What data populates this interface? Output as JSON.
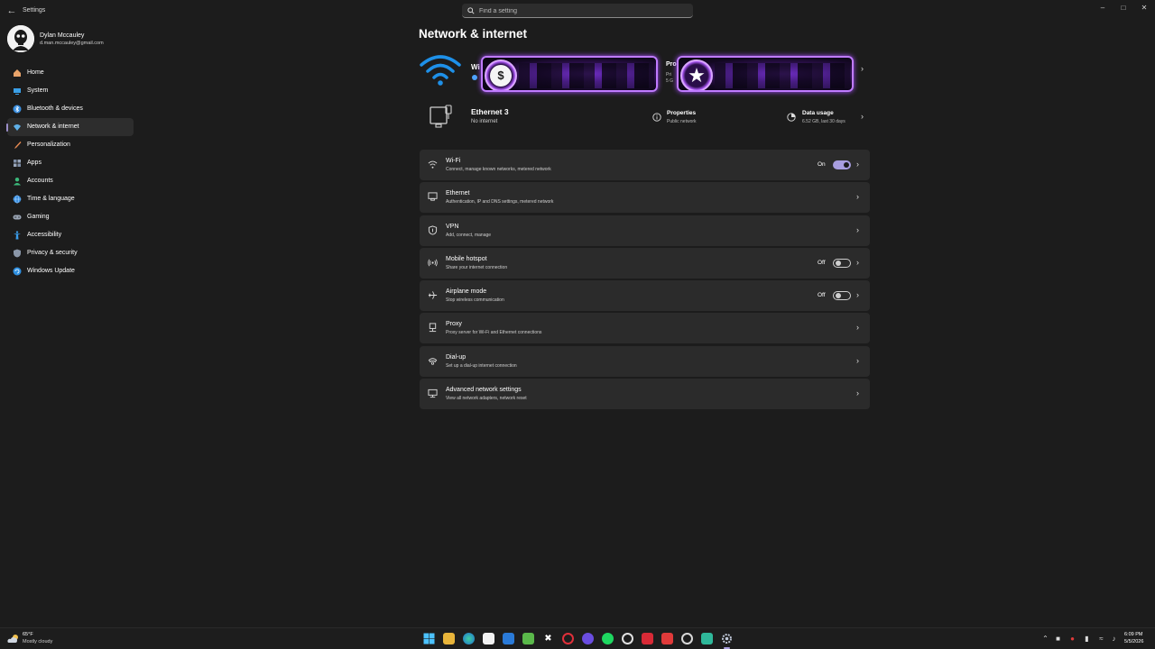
{
  "window": {
    "title": "Settings",
    "search_placeholder": "Find a setting"
  },
  "user": {
    "name": "Dylan Mccauley",
    "email": "d.man.mccauley@gmail.com"
  },
  "sidebar": {
    "items": [
      {
        "label": "Home",
        "icon": "home-icon",
        "color": "#e8a36a"
      },
      {
        "label": "System",
        "icon": "system-icon",
        "color": "#3aa0e8"
      },
      {
        "label": "Bluetooth & devices",
        "icon": "bluetooth-icon",
        "color": "#3a8fe0"
      },
      {
        "label": "Network & internet",
        "icon": "network-icon",
        "color": "#5fb0e8",
        "active": true
      },
      {
        "label": "Personalization",
        "icon": "brush-icon",
        "color": "#e88a52"
      },
      {
        "label": "Apps",
        "icon": "apps-icon",
        "color": "#7f8fa8"
      },
      {
        "label": "Accounts",
        "icon": "accounts-icon",
        "color": "#3bb87a"
      },
      {
        "label": "Time & language",
        "icon": "globe-icon",
        "color": "#3a8fe0"
      },
      {
        "label": "Gaming",
        "icon": "gamepad-icon",
        "color": "#9aa5b5"
      },
      {
        "label": "Accessibility",
        "icon": "accessibility-icon",
        "color": "#3a9be8"
      },
      {
        "label": "Privacy & security",
        "icon": "shield-icon",
        "color": "#8a96a8"
      },
      {
        "label": "Windows Update",
        "icon": "update-icon",
        "color": "#2e8fe0"
      }
    ]
  },
  "main": {
    "title": "Network & internet",
    "hero": {
      "wifi_label": "Wi",
      "props_label": "Pro",
      "props_sub1": "Pri",
      "props_sub2": "5 G"
    },
    "ethernet": {
      "name": "Ethernet 3",
      "status": "No internet",
      "properties_label": "Properties",
      "properties_sub": "Public network",
      "usage_label": "Data usage",
      "usage_sub": "6.52 GB, last 30 days"
    },
    "rows": [
      {
        "title": "Wi-Fi",
        "sub": "Connect, manage known networks, metered network",
        "toggle": "On"
      },
      {
        "title": "Ethernet",
        "sub": "Authentication, IP and DNS settings, metered network"
      },
      {
        "title": "VPN",
        "sub": "Add, connect, manage"
      },
      {
        "title": "Mobile hotspot",
        "sub": "Share your internet connection",
        "toggle": "Off"
      },
      {
        "title": "Airplane mode",
        "sub": "Stop wireless communication",
        "toggle": "Off"
      },
      {
        "title": "Proxy",
        "sub": "Proxy server for Wi-Fi and Ethernet connections"
      },
      {
        "title": "Dial-up",
        "sub": "Set up a dial-up internet connection"
      },
      {
        "title": "Advanced network settings",
        "sub": "View all network adapters, network reset"
      }
    ]
  },
  "overlay": {
    "badge1_symbol": "$",
    "badge2_symbol": "★"
  },
  "taskbar": {
    "weather_temp": "65°F",
    "weather_desc": "Mostly cloudy",
    "time": "6:09 PM",
    "date": "5/5/2026"
  },
  "colors": {
    "accent": "#a89ee0",
    "wifi_blue": "#1e90e8"
  }
}
